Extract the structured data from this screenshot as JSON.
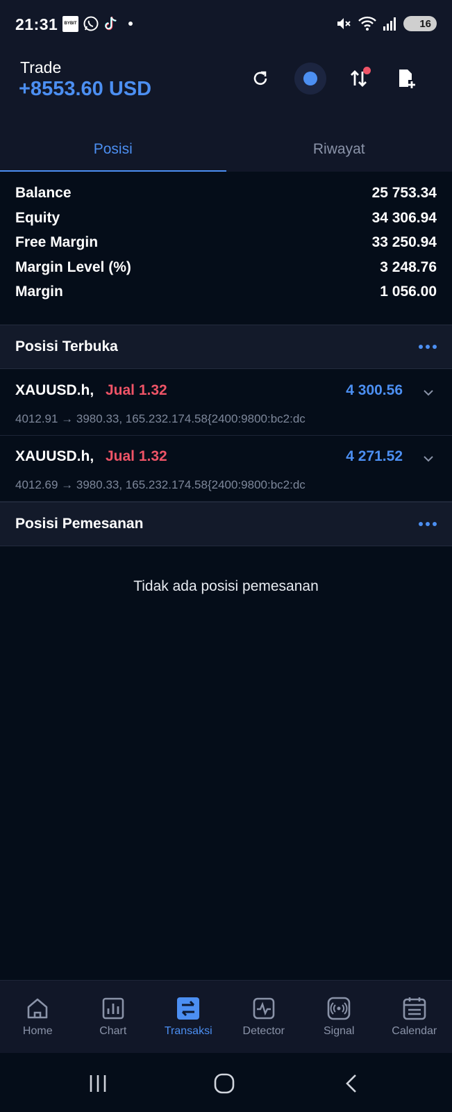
{
  "status_bar": {
    "time": "21:31",
    "left_icons": [
      "bybit-icon",
      "whatsapp-icon",
      "tiktok-icon"
    ],
    "bybit_text": "BYBIT",
    "right_icons": [
      "mute-icon",
      "wifi-icon",
      "signal-icon"
    ],
    "battery": "16"
  },
  "header": {
    "title": "Trade",
    "amount": "+8553.60 USD",
    "actions": [
      "refresh-icon",
      "record-icon",
      "sort-arrows-icon",
      "add-file-icon"
    ]
  },
  "tabs": [
    {
      "label": "Posisi",
      "active": true
    },
    {
      "label": "Riwayat",
      "active": false
    }
  ],
  "account": [
    {
      "label": "Balance",
      "value": "25 753.34"
    },
    {
      "label": "Equity",
      "value": "34 306.94"
    },
    {
      "label": "Free Margin",
      "value": "33 250.94"
    },
    {
      "label": "Margin Level (%)",
      "value": "3 248.76"
    },
    {
      "label": "Margin",
      "value": "1 056.00"
    }
  ],
  "open_positions": {
    "title": "Posisi Terbuka",
    "items": [
      {
        "symbol": "XAUUSD.h,",
        "side": "Jual 1.32",
        "profit": "4 300.56",
        "detail": "4012.91 → 3980.33, 165.232.174.58{2400:9800:bc2:dc"
      },
      {
        "symbol": "XAUUSD.h,",
        "side": "Jual 1.32",
        "profit": "4 271.52",
        "detail": "4012.69 → 3980.33, 165.232.174.58{2400:9800:bc2:dc"
      }
    ]
  },
  "pending_orders": {
    "title": "Posisi Pemesanan",
    "empty_text": "Tidak ada posisi pemesanan"
  },
  "bottom_nav": [
    {
      "label": "Home",
      "icon": "home-icon",
      "active": false
    },
    {
      "label": "Chart",
      "icon": "chart-icon",
      "active": false
    },
    {
      "label": "Transaksi",
      "icon": "transaction-icon",
      "active": true
    },
    {
      "label": "Detector",
      "icon": "detector-icon",
      "active": false
    },
    {
      "label": "Signal",
      "icon": "signal-broadcast-icon",
      "active": false
    },
    {
      "label": "Calendar",
      "icon": "calendar-icon",
      "active": false
    }
  ],
  "colors": {
    "accent": "#4c8ff2",
    "sell": "#ef5467",
    "background": "#050d19",
    "panel": "#111728"
  }
}
